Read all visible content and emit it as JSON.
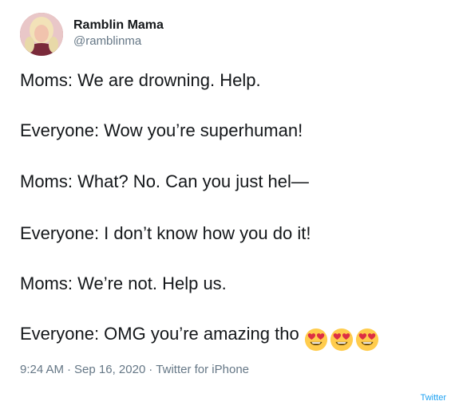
{
  "author": {
    "name": "Ramblin Mama",
    "handle": "@ramblinma"
  },
  "tweet": {
    "lines": [
      "Moms: We are drowning. Help.",
      "Everyone: Wow you’re superhuman!",
      "Moms: What? No. Can you just hel—",
      "Everyone: I don’t know how you do it!",
      "Moms: We’re not. Help us.",
      "Everyone: OMG you’re amazing tho"
    ],
    "emojis": [
      "heart-eyes-emoji",
      "heart-eyes-emoji",
      "heart-eyes-emoji"
    ]
  },
  "meta": {
    "time": "9:24 AM",
    "date": "Sep 16, 2020",
    "client": "Twitter for iPhone",
    "separator": "·"
  },
  "source_label": "Twitter",
  "colors": {
    "text": "#14171a",
    "secondary": "#657786",
    "link": "#1da1f2"
  }
}
